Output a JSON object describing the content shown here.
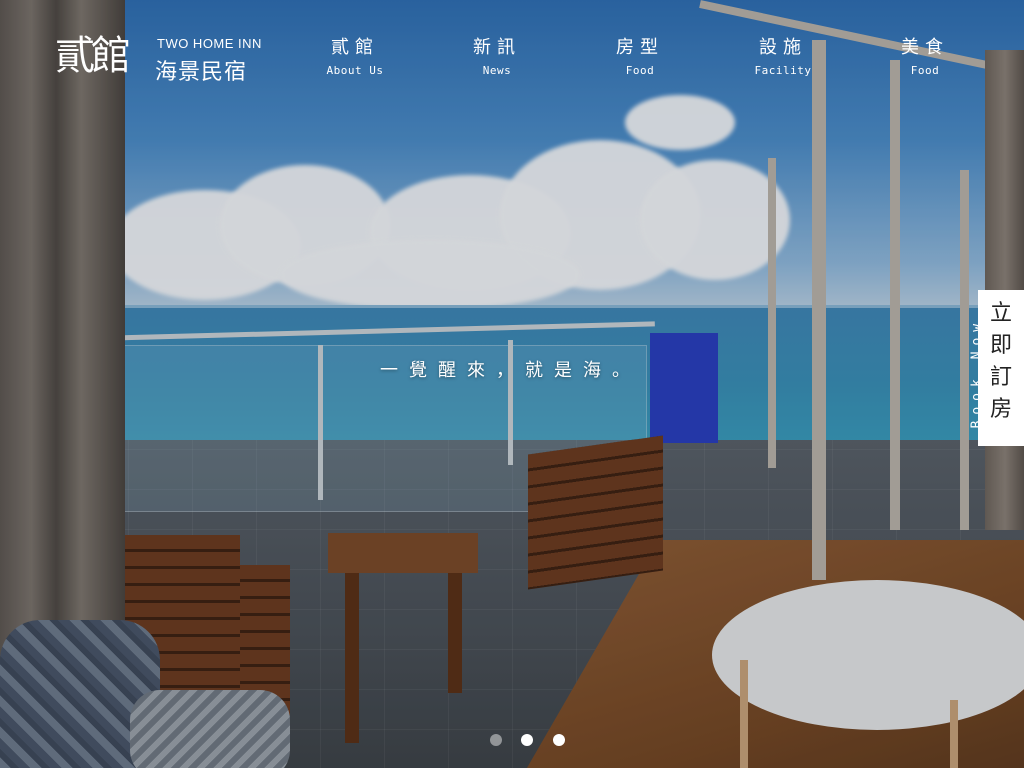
{
  "logo": {
    "glyph": "貳館",
    "en": "TWO HOME INN",
    "zh": "海景民宿"
  },
  "nav": [
    {
      "zh": "貳館",
      "en": "About Us"
    },
    {
      "zh": "新訊",
      "en": "News"
    },
    {
      "zh": "房型",
      "en": "Food"
    },
    {
      "zh": "設施",
      "en": "Facility"
    },
    {
      "zh": "美食",
      "en": "Food"
    }
  ],
  "hero": {
    "slogan": "一覺醒來，就是海。"
  },
  "book_now": {
    "en": "Book Now",
    "zh": [
      "立",
      "即",
      "訂",
      "房"
    ]
  },
  "slider": {
    "dot_count": 3,
    "active_index": 0
  }
}
